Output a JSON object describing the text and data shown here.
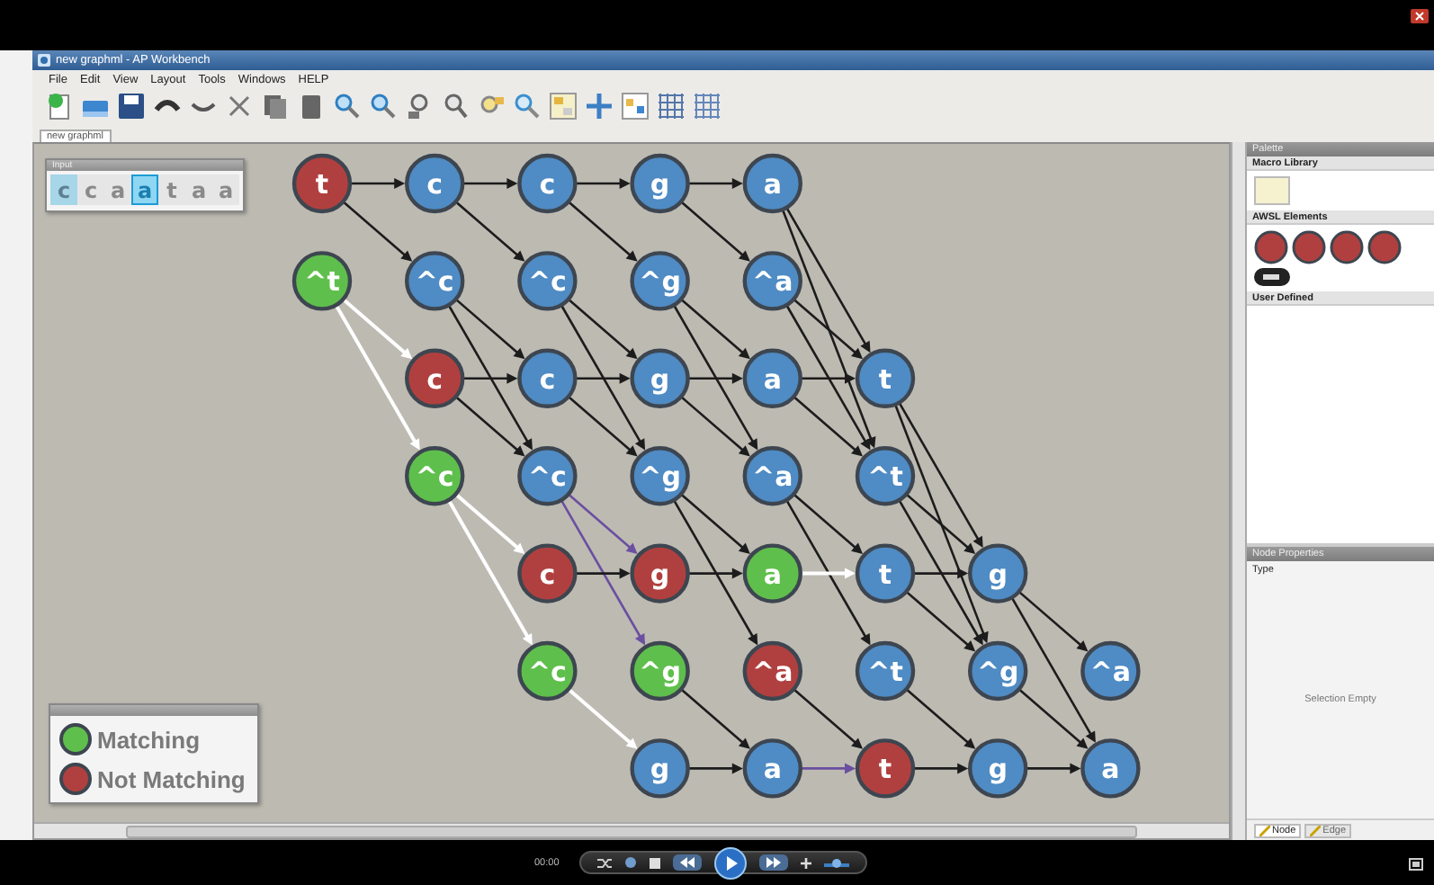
{
  "video": {
    "time": "00:00"
  },
  "window": {
    "title": "new graphml - AP Workbench"
  },
  "menu": [
    "File",
    "Edit",
    "View",
    "Layout",
    "Tools",
    "Windows",
    "HELP"
  ],
  "document_tab": {
    "label": "new graphml"
  },
  "input_panel": {
    "title": "Input",
    "symbols": [
      {
        "text": "c",
        "highlighted": true,
        "selected": false
      },
      {
        "text": "c",
        "highlighted": false,
        "selected": false
      },
      {
        "text": "a",
        "highlighted": false,
        "selected": false
      },
      {
        "text": "a",
        "highlighted": false,
        "selected": true
      },
      {
        "text": "t",
        "highlighted": false,
        "selected": false
      },
      {
        "text": "a",
        "highlighted": false,
        "selected": false
      },
      {
        "text": "a",
        "highlighted": false,
        "selected": false
      }
    ]
  },
  "graph": {
    "rows": [
      {
        "nodes": [
          {
            "label": "t",
            "color": "#b0403f",
            "arrow_right": {
              "color": "#1c1c1c"
            },
            "arrow_down_1": {
              "color": "#1c1c1c"
            }
          },
          {
            "label": "c",
            "color": "#4f8bc4",
            "arrow_right": {
              "color": "#1c1c1c"
            },
            "arrow_down_1": {
              "color": "#1c1c1c"
            }
          },
          {
            "label": "c",
            "color": "#4f8bc4",
            "arrow_right": {
              "color": "#1c1c1c"
            },
            "arrow_down_1": {
              "color": "#1c1c1c"
            }
          },
          {
            "label": "g",
            "color": "#4f8bc4",
            "arrow_right": {
              "color": "#1c1c1c"
            },
            "arrow_down_1": {
              "color": "#1c1c1c"
            }
          },
          {
            "label": "a",
            "color": "#4f8bc4",
            "arrow_down_2": {
              "color": "#1c1c1c"
            },
            "arrow_down_3": {
              "color": "#1c1c1c"
            }
          }
        ]
      },
      {
        "nodes": [
          {
            "label": "^t",
            "color": "#5fbf4c",
            "arrow_down_1": {
              "color": "#ffffff"
            },
            "arrow_down_2": {
              "color": "#ffffff"
            }
          },
          {
            "label": "^c",
            "color": "#4f8bc4",
            "arrow_down_1": {
              "color": "#1c1c1c"
            },
            "arrow_down_2": {
              "color": "#1c1c1c"
            }
          },
          {
            "label": "^c",
            "color": "#4f8bc4",
            "arrow_down_1": {
              "color": "#1c1c1c"
            },
            "arrow_down_2": {
              "color": "#1c1c1c"
            }
          },
          {
            "label": "^g",
            "color": "#4f8bc4",
            "arrow_down_1": {
              "color": "#1c1c1c"
            },
            "arrow_down_2": {
              "color": "#1c1c1c"
            }
          },
          {
            "label": "^a",
            "color": "#4f8bc4",
            "arrow_down_1": {
              "color": "#1c1c1c"
            },
            "arrow_down_2": {
              "color": "#1c1c1c"
            }
          }
        ]
      },
      {
        "nodes": [
          {
            "label": "c",
            "color": "#b0403f",
            "arrow_right": {
              "color": "#1c1c1c"
            },
            "arrow_down_1": {
              "color": "#1c1c1c"
            }
          },
          {
            "label": "c",
            "color": "#4f8bc4",
            "arrow_right": {
              "color": "#1c1c1c"
            },
            "arrow_down_1": {
              "color": "#1c1c1c"
            }
          },
          {
            "label": "g",
            "color": "#4f8bc4",
            "arrow_right": {
              "color": "#1c1c1c"
            },
            "arrow_down_1": {
              "color": "#1c1c1c"
            }
          },
          {
            "label": "a",
            "color": "#4f8bc4",
            "arrow_right": {
              "color": "#1c1c1c"
            },
            "arrow_down_1": {
              "color": "#1c1c1c"
            }
          },
          {
            "label": "t",
            "color": "#4f8bc4",
            "arrow_down_2": {
              "color": "#1c1c1c"
            },
            "arrow_down_3": {
              "color": "#1c1c1c"
            }
          }
        ]
      },
      {
        "nodes": [
          {
            "label": "^c",
            "color": "#5fbf4c",
            "arrow_down_1": {
              "color": "#ffffff"
            },
            "arrow_down_2": {
              "color": "#ffffff"
            }
          },
          {
            "label": "^c",
            "color": "#4f8bc4",
            "arrow_down_1": {
              "color": "#6b4fa0"
            },
            "arrow_down_2": {
              "color": "#6b4fa0"
            }
          },
          {
            "label": "^g",
            "color": "#4f8bc4",
            "arrow_down_1": {
              "color": "#1c1c1c"
            },
            "arrow_down_2": {
              "color": "#1c1c1c"
            }
          },
          {
            "label": "^a",
            "color": "#4f8bc4",
            "arrow_down_1": {
              "color": "#1c1c1c"
            },
            "arrow_down_2": {
              "color": "#1c1c1c"
            }
          },
          {
            "label": "^t",
            "color": "#4f8bc4",
            "arrow_down_1": {
              "color": "#1c1c1c"
            },
            "arrow_down_2": {
              "color": "#1c1c1c"
            }
          }
        ]
      },
      {
        "nodes": [
          {
            "label": "c",
            "color": "#b0403f",
            "arrow_right": {
              "color": "#1c1c1c"
            }
          },
          {
            "label": "g",
            "color": "#b0403f",
            "arrow_right": {
              "color": "#1c1c1c"
            }
          },
          {
            "label": "a",
            "color": "#5fbf4c",
            "arrow_right": {
              "color": "#ffffff"
            }
          },
          {
            "label": "t",
            "color": "#4f8bc4",
            "arrow_right": {
              "color": "#1c1c1c"
            },
            "arrow_down_1": {
              "color": "#1c1c1c"
            }
          },
          {
            "label": "g",
            "color": "#4f8bc4",
            "arrow_down_1": {
              "color": "#1c1c1c"
            },
            "arrow_down_2": {
              "color": "#1c1c1c"
            }
          }
        ]
      },
      {
        "nodes": [
          {
            "label": "^c",
            "color": "#5fbf4c",
            "arrow_down_1": {
              "color": "#ffffff"
            }
          },
          {
            "label": "^g",
            "color": "#5fbf4c",
            "arrow_down_1": {
              "color": "#1c1c1c"
            }
          },
          {
            "label": "^a",
            "color": "#b0403f",
            "arrow_down_1": {
              "color": "#1c1c1c"
            }
          },
          {
            "label": "^t",
            "color": "#4f8bc4",
            "arrow_down_1": {
              "color": "#1c1c1c"
            }
          },
          {
            "label": "^g",
            "color": "#4f8bc4",
            "arrow_down_1": {
              "color": "#1c1c1c"
            }
          },
          {
            "label": "^a",
            "color": "#4f8bc4"
          }
        ]
      },
      {
        "nodes": [
          {
            "label": "g",
            "color": "#4f8bc4",
            "arrow_right": {
              "color": "#1c1c1c"
            }
          },
          {
            "label": "a",
            "color": "#4f8bc4",
            "arrow_right": {
              "color": "#6b4fa0"
            }
          },
          {
            "label": "t",
            "color": "#b0403f",
            "arrow_right": {
              "color": "#1c1c1c"
            }
          },
          {
            "label": "g",
            "color": "#4f8bc4",
            "arrow_right": {
              "color": "#1c1c1c"
            }
          },
          {
            "label": "a",
            "color": "#4f8bc4"
          }
        ]
      }
    ]
  },
  "legend": [
    {
      "label": "Matching",
      "color": "#5fbf4c"
    },
    {
      "label": "Not Matching",
      "color": "#b0403f"
    }
  ],
  "palette": {
    "title": "Palette",
    "sections": [
      {
        "title": "Macro Library",
        "kind": "macros"
      },
      {
        "title": "AWSL Elements",
        "kind": "elements"
      },
      {
        "title": "User Defined",
        "kind": "user"
      }
    ]
  },
  "properties": {
    "title": "Node Properties",
    "label": "Type",
    "empty_text": "Selection Empty",
    "tabs": [
      {
        "label": "Node",
        "selected": true
      },
      {
        "label": "Edge",
        "selected": false
      }
    ]
  }
}
